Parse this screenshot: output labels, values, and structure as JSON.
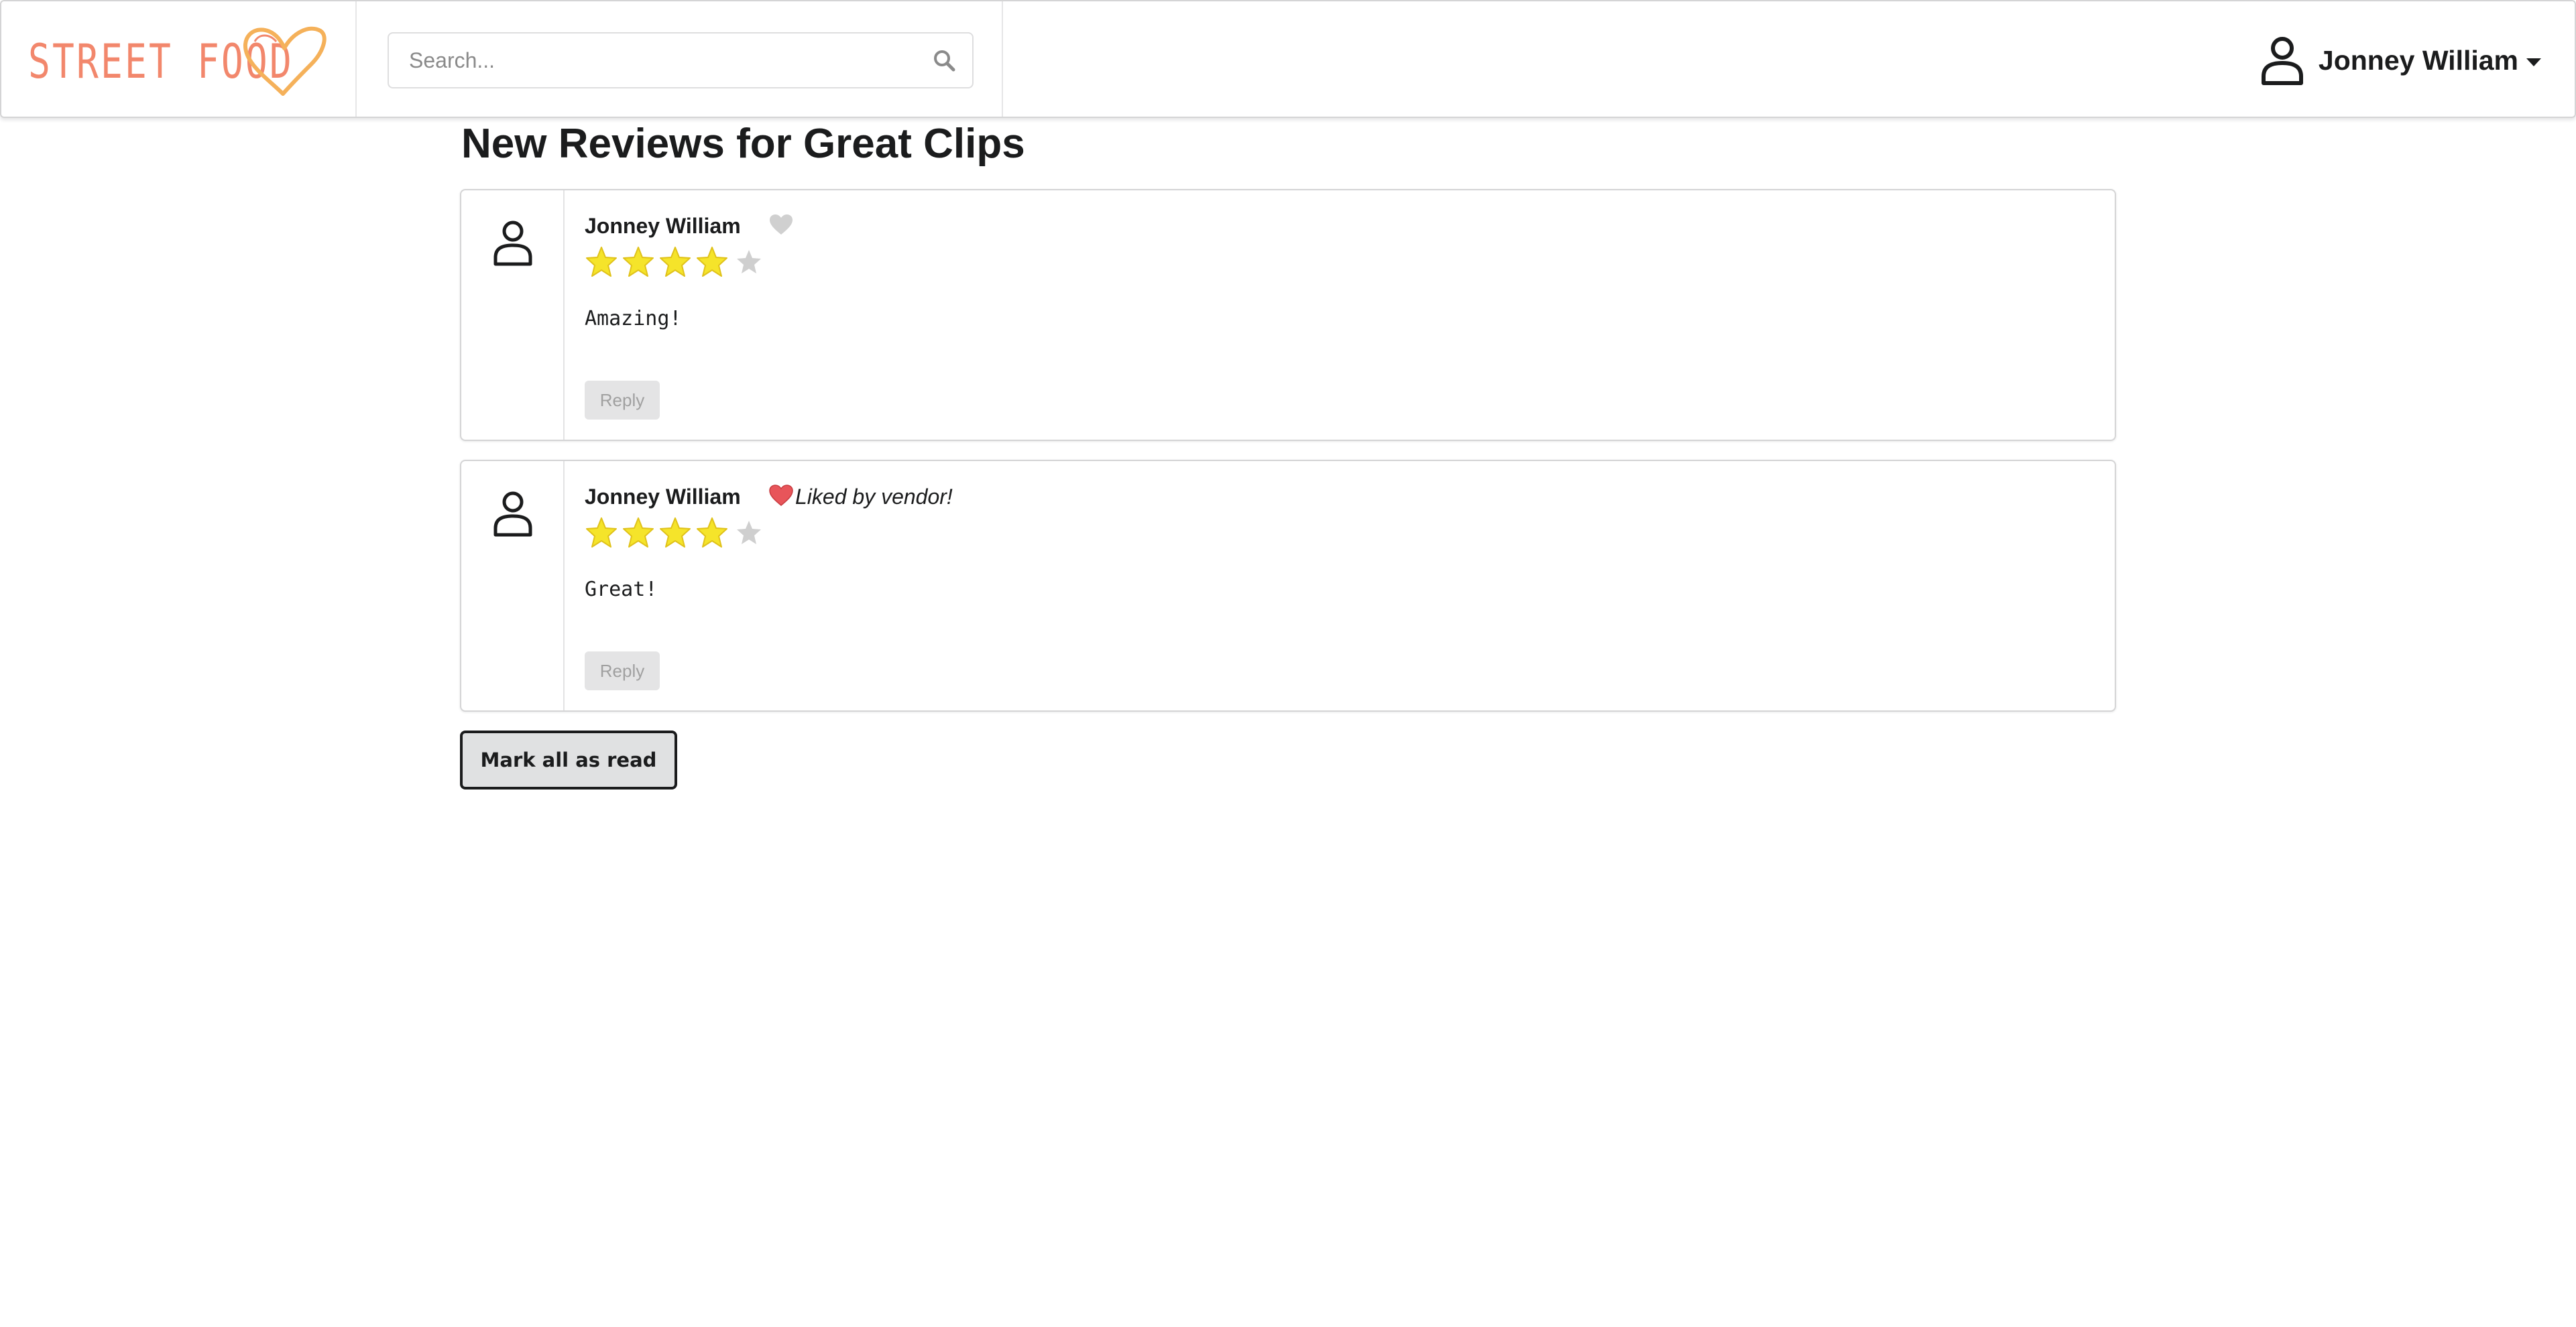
{
  "app": {
    "logo_text": "STREET FOOD",
    "brand_color": "#f2876c",
    "heart_accent": "#f5b15a"
  },
  "header": {
    "search": {
      "placeholder": "Search...",
      "value": ""
    },
    "user": {
      "name": "Jonney William",
      "icon": "user-icon"
    }
  },
  "page": {
    "title": "New Reviews for Great Clips"
  },
  "reviews": [
    {
      "author": "Jonney William",
      "rating": 4,
      "max_rating": 5,
      "liked_by_vendor": false,
      "liked_text": "",
      "text": "Amazing!",
      "reply_label": "Reply"
    },
    {
      "author": "Jonney William",
      "rating": 4,
      "max_rating": 5,
      "liked_by_vendor": true,
      "liked_text": "Liked by vendor!",
      "text": "Great!",
      "reply_label": "Reply"
    }
  ],
  "actions": {
    "mark_all_read_label": "Mark all as read"
  },
  "colors": {
    "star_filled": "#f5e42a",
    "star_empty": "#cfcfcf",
    "heart_liked": "#e8555a",
    "heart_unliked": "#d0d0d0"
  }
}
